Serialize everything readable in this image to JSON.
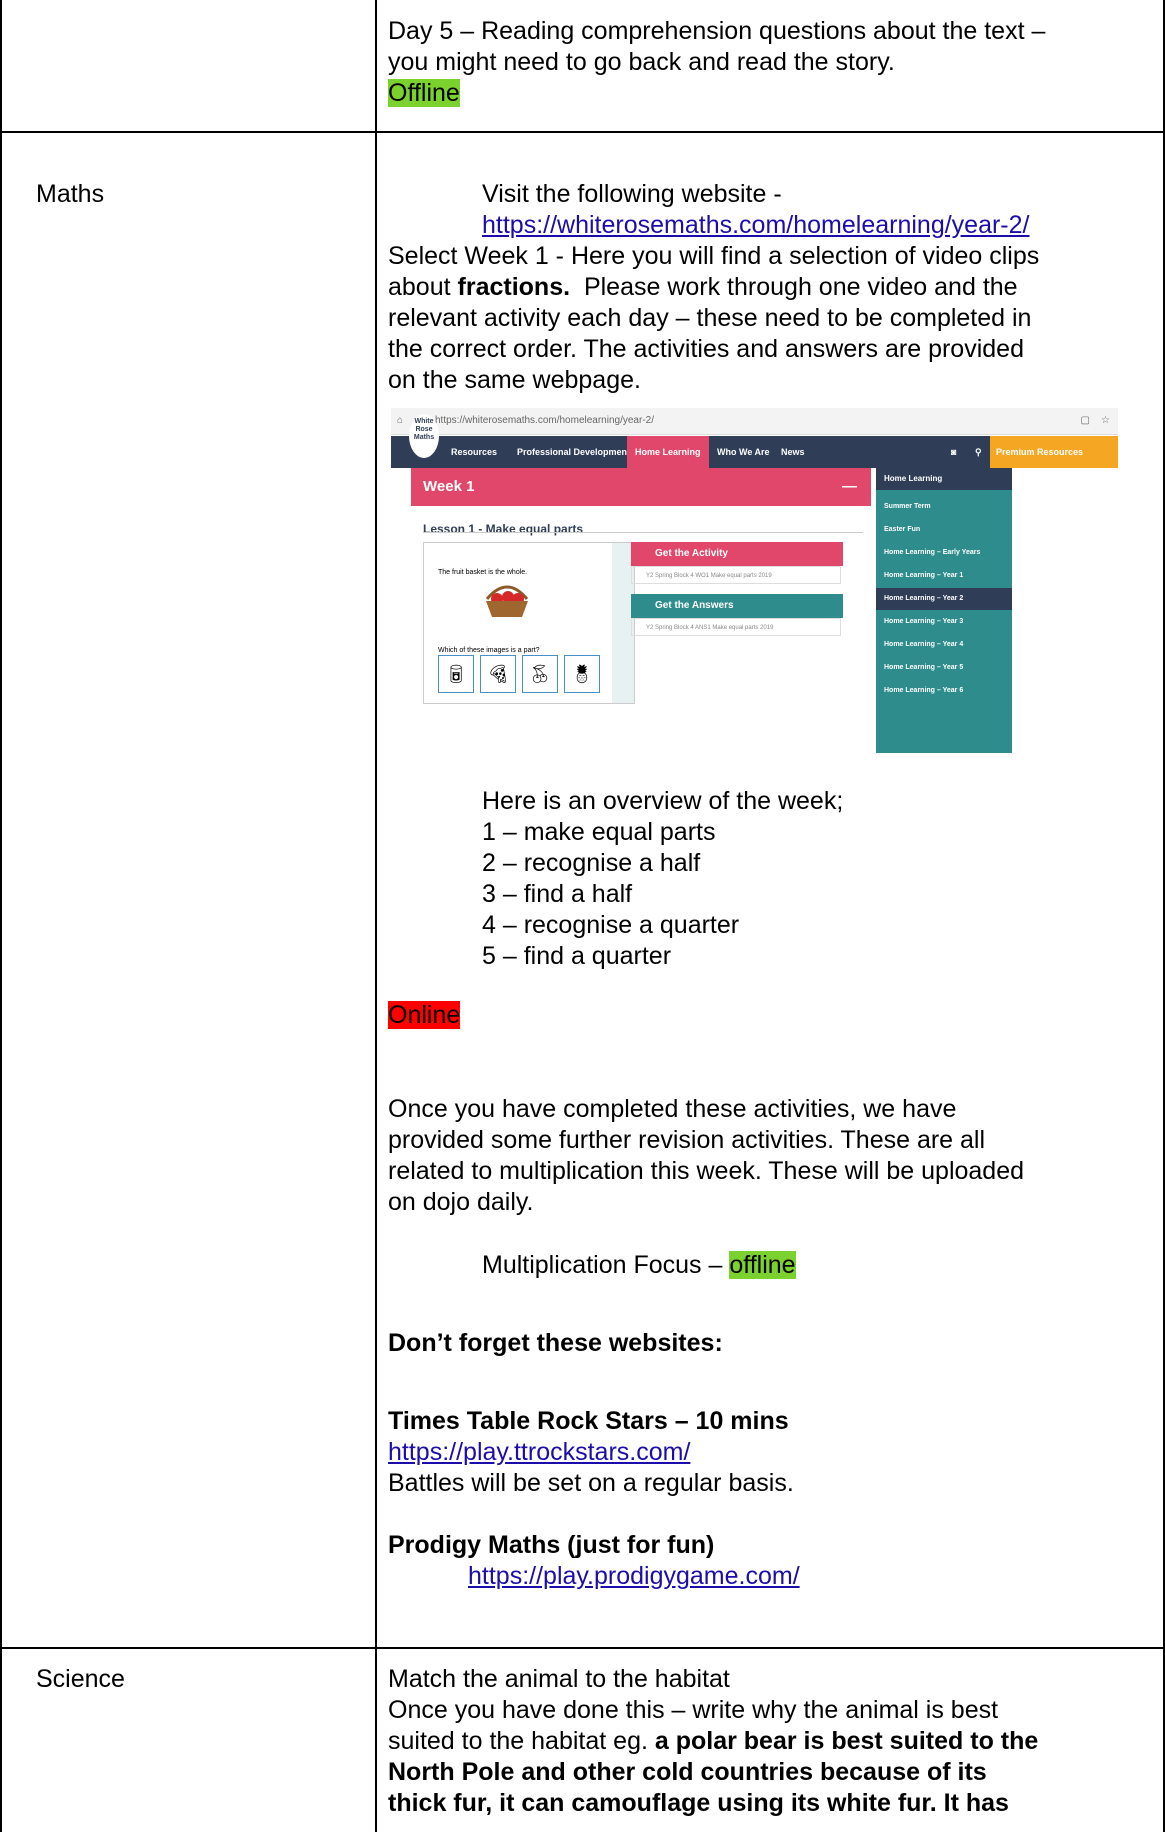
{
  "rows": {
    "top": {
      "line1": "Day 5 – Reading comprehension questions about the text –",
      "line2": "you might need to go back and read the story.",
      "badge": "Offline"
    },
    "maths": {
      "label": "Maths",
      "visit": "Visit the following website -",
      "link": "https://whiterosemaths.com/homelearning/year-2/",
      "select_pre": "Select Week 1 - Here you will find a selection of video clips",
      "about_pre": "about ",
      "about_bold": "fractions.",
      "about_post": "  Please work through one video and the",
      "l3": "relevant activity each day – these need to be completed in",
      "l4": "the correct order.  The activities and answers are provided",
      "l5": "on the same webpage.",
      "overview_title": "Here is an overview of the week;",
      "overview": [
        "1 – make equal parts",
        "2 – recognise a half",
        "3 – find a half",
        "4 – recognise a quarter",
        "5 – find a quarter"
      ],
      "online_badge": "Online",
      "para": [
        "Once you have completed these activities, we have",
        "provided some further revision activities. These are all",
        "related to multiplication this week. These will be uploaded",
        "on dojo daily."
      ],
      "mult_pre": "Multiplication Focus – ",
      "mult_badge": "offline",
      "dont_forget": "Don’t forget these websites:",
      "ttrs_title": "Times Table Rock Stars – 10 mins",
      "ttrs_link": "https://play.ttrockstars.com/",
      "ttrs_note": "Battles will be set on a regular basis.",
      "prodigy_title": "Prodigy Maths (just for fun)",
      "prodigy_link": "https://play.prodigygame.com/"
    },
    "science": {
      "label": "Science",
      "l1": "Match the animal to the habitat",
      "l2": "Once you have done this – write why the animal is best",
      "l3_pre": "suited to the habitat eg. ",
      "l3_bold": "a polar bear is best suited to the",
      "l4": "North Pole and other cold countries because of its",
      "l5": "thick fur, it can camouflage using its white fur. It has"
    }
  },
  "screenshot": {
    "url": "https://whiterosemaths.com/homelearning/year-2/",
    "logo": "White Rose Maths",
    "nav": [
      "Resources",
      "Professional Development",
      "Home Learning",
      "Who We Are",
      "News"
    ],
    "premium": "Premium Resources Centre",
    "week": "Week 1",
    "lesson": "Lesson 1 - Make equal parts",
    "slide_text1": "The fruit basket is the whole.",
    "slide_text2": "Which of these images is a part?",
    "get_activity": "Get the Activity",
    "activity_file": "Y2 Spring Block 4 WO1 Make equal parts 2019",
    "get_answers": "Get the Answers",
    "answers_file": "Y2 Spring Block 4 ANS1 Make equal parts 2019",
    "side_header": "Home Learning",
    "side_items": [
      "Summer Term",
      "Easter Fun",
      "Home Learning – Early Years",
      "Home Learning – Year 1",
      "Home Learning – Year 2",
      "Home Learning – Year 3",
      "Home Learning – Year 4",
      "Home Learning – Year 5",
      "Home Learning – Year 6"
    ],
    "colors": {
      "navy": "#2f3d57",
      "pink": "#e0476b",
      "teal": "#2f8c8c",
      "orange": "#f5a623"
    }
  }
}
